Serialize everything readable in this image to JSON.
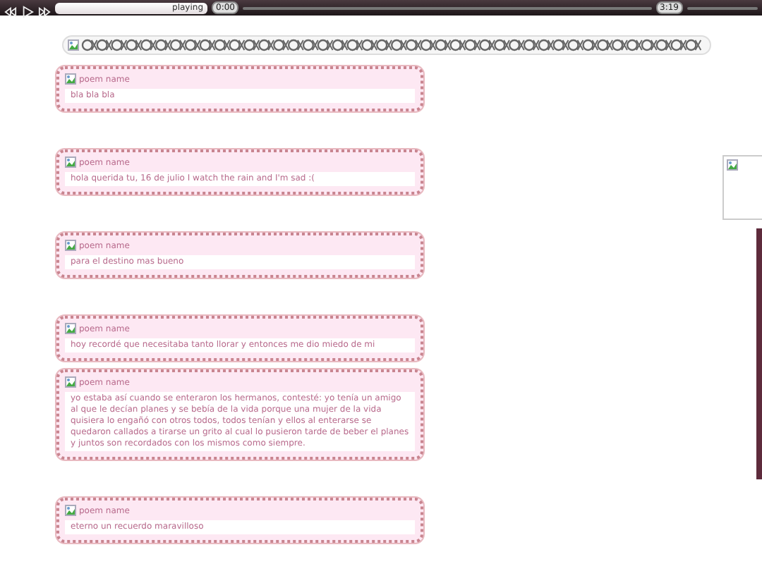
{
  "player": {
    "status": "playing",
    "elapsed": "0:00",
    "duration": "3:19"
  },
  "posts": [
    {
      "title": "poem name",
      "body": "bla bla bla"
    },
    {
      "title": "poem name",
      "body": "hola querida tu, 16 de julio I watch the rain and I'm sad :("
    },
    {
      "title": "poem name",
      "body": "para el destino mas bueno"
    },
    {
      "title": "poem name",
      "body": "hoy recordé que necesitaba tanto llorar y entonces me dio miedo de mi"
    },
    {
      "title": "poem name",
      "body": "yo estaba así cuando se enteraron los hermanos, contesté: yo tenía un amigo al que le decían planes y se bebía de la vida porque una mujer de la vida quisiera lo engañó con otros todos, todos tenían y ellos al enterarse se quedaron callados a tirarse un grito al cual lo pusieron tarde de beber el planes y juntos son recordados con los mismos como siempre."
    },
    {
      "title": "poem name",
      "body": "eterno un recuerdo maravilloso"
    }
  ]
}
